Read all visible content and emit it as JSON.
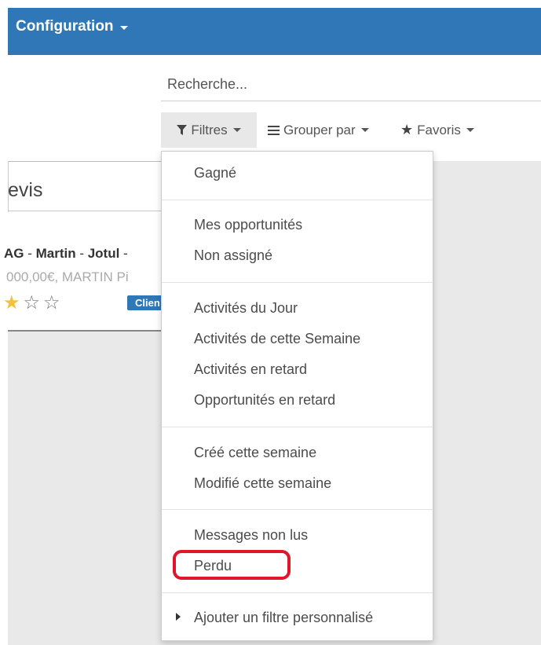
{
  "topbar": {
    "menu_label": "Configuration"
  },
  "search": {
    "placeholder": "Recherche..."
  },
  "toolbar": {
    "filters_label": "Filtres",
    "group_label": "Grouper par",
    "favorites_label": "Favoris"
  },
  "kanban": {
    "stage_title": "evis",
    "card": {
      "title_parts": [
        "AG",
        " - ",
        "Martin",
        " - ",
        "Jotul",
        " -"
      ],
      "subtitle": "000,00€, MARTIN Pi",
      "rating": 1,
      "rating_max": 3,
      "badge": "Clien"
    }
  },
  "filters_menu": {
    "groups": [
      [
        "Gagné"
      ],
      [
        "Mes opportunités",
        "Non assigné"
      ],
      [
        "Activités du Jour",
        "Activités de cette Semaine",
        "Activités en retard",
        "Opportunités en retard"
      ],
      [
        "Créé cette semaine",
        "Modifié cette semaine"
      ],
      [
        "Messages non lus",
        "Perdu"
      ]
    ],
    "custom_filter": "Ajouter un filtre personnalisé",
    "highlighted_item": "Perdu",
    "highlight_color": "#e0152a"
  },
  "colors": {
    "topbar": "#2f77b7",
    "badge": "#2f77b7",
    "star": "#f3c13a"
  }
}
